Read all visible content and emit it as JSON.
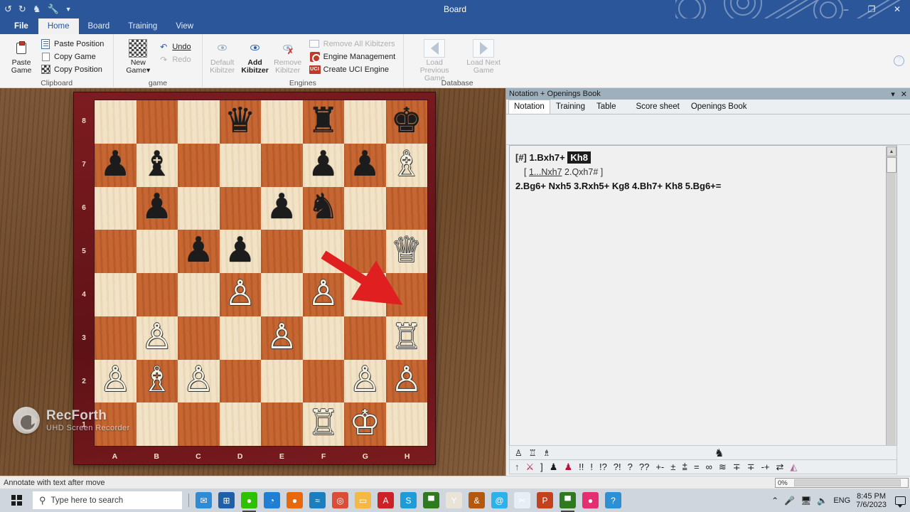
{
  "window": {
    "title": "Board",
    "quick_access": [
      "undo-icon",
      "redo-icon",
      "chess-knight-icon",
      "wrench-icon",
      "chevron-down-icon"
    ],
    "minimize": "–",
    "maximize": "❐",
    "close": "✕",
    "help": "?"
  },
  "ribbon": {
    "tabs": [
      {
        "label": "File",
        "active": false,
        "file": true
      },
      {
        "label": "Home",
        "active": true
      },
      {
        "label": "Board",
        "active": false
      },
      {
        "label": "Training",
        "active": false
      },
      {
        "label": "View",
        "active": false
      }
    ],
    "groups": [
      {
        "label": "Clipboard",
        "big": [
          {
            "label_line1": "Paste",
            "label_line2": "Game",
            "icon": "clipboard-icon",
            "disabled": false
          }
        ],
        "small": [
          {
            "label": "Paste Position",
            "icon": "paste-position-icon",
            "disabled": false
          },
          {
            "label": "Copy Game",
            "icon": "copy-game-icon",
            "disabled": false
          },
          {
            "label": "Copy Position",
            "icon": "copy-position-icon",
            "disabled": false
          }
        ]
      },
      {
        "label": "game",
        "big": [
          {
            "label_line1": "New",
            "label_line2": "Game▾",
            "icon": "new-game-board-icon",
            "disabled": false
          }
        ],
        "small": [
          {
            "label": "Undo",
            "icon": "undo-icon",
            "disabled": false
          },
          {
            "label": "Redo",
            "icon": "redo-icon",
            "disabled": true
          }
        ]
      },
      {
        "label": "Engines",
        "big": [
          {
            "label_line1": "Default",
            "label_line2": "Kibitzer",
            "icon": "default-kibitzer-icon",
            "disabled": true
          },
          {
            "label_line1": "Add",
            "label_line2": "Kibitzer",
            "icon": "add-kibitzer-icon",
            "disabled": false
          },
          {
            "label_line1": "Remove",
            "label_line2": "Kibitzer",
            "icon": "remove-kibitzer-icon",
            "disabled": true
          }
        ],
        "small": [
          {
            "label": "Remove All Kibitzers",
            "icon": "remove-all-kibitzers-icon",
            "disabled": true
          },
          {
            "label": "Engine Management",
            "icon": "engine-management-icon",
            "disabled": false
          },
          {
            "label": "Create UCI Engine",
            "icon": "uci-engine-icon",
            "disabled": false
          }
        ]
      },
      {
        "label": "Database",
        "big": [
          {
            "label_line1": "Load Previous",
            "label_line2": "Game",
            "icon": "arrow-left-icon",
            "disabled": true
          },
          {
            "label_line1": "Load Next",
            "label_line2": "Game",
            "icon": "arrow-right-icon",
            "disabled": true
          }
        ],
        "small": []
      }
    ]
  },
  "board": {
    "ranks": [
      "8",
      "7",
      "6",
      "5",
      "4",
      "3",
      "2",
      "1"
    ],
    "files": [
      "A",
      "B",
      "C",
      "D",
      "E",
      "F",
      "G",
      "H"
    ],
    "position": [
      [
        "",
        "",
        "",
        "q",
        "",
        "r",
        "",
        "k"
      ],
      [
        "p",
        "b",
        "",
        "",
        "",
        "p",
        "p",
        "B"
      ],
      [
        "",
        "p",
        "",
        "",
        "p",
        "n",
        "",
        ""
      ],
      [
        "",
        "",
        "p",
        "p",
        "",
        "",
        "",
        "Q"
      ],
      [
        "",
        "",
        "",
        "P",
        "",
        "P",
        "",
        ""
      ],
      [
        "",
        "P",
        "",
        "",
        "P",
        "",
        "",
        "R"
      ],
      [
        "P",
        "B",
        "P",
        "",
        "",
        "",
        "P",
        "P"
      ],
      [
        "",
        "",
        "",
        "",
        "",
        "R",
        "K",
        ""
      ]
    ],
    "arrow": {
      "from": "f6",
      "to": "h5",
      "color": "#e02020"
    }
  },
  "watermark": {
    "title": "RecForth",
    "subtitle": "UHD Screen Recorder",
    "icon": "video-camera-icon"
  },
  "notation_panel": {
    "title": "Notation + Openings Book",
    "collapse": "▾",
    "close": "✕",
    "tabs": [
      {
        "label": "Notation",
        "active": true
      },
      {
        "label": "Training",
        "active": false
      },
      {
        "label": "Table",
        "active": false
      },
      {
        "label": "Score sheet",
        "active": false,
        "spaced": true
      },
      {
        "label": "Openings Book",
        "active": false
      }
    ],
    "moves": {
      "tag": "[#]",
      "line1_main": "1.Bxh7+",
      "line1_highlight": "Kh8",
      "variation_open": "[",
      "variation_move1": "1...Nxh7",
      "variation_move2": "2.Qxh7#",
      "variation_close": "]",
      "line2": "2.Bg6+  Nxh5  3.Rxh5+  Kg8  4.Bh7+  Kh8  5.Bg6+="
    },
    "toolbar_pieces": [
      "white-pawn-icon",
      "white-rook-icon",
      "white-bishop-icon"
    ],
    "toolbar_knight": "black-knight-icon",
    "annotation_symbols": [
      "↑",
      "⚔",
      "]",
      "♟",
      "♟",
      "!!",
      "!",
      "!?",
      "?!",
      "?",
      "??",
      "+-",
      "±",
      "⩲",
      "=",
      "∞",
      "≋",
      "∓",
      "∓",
      "-+",
      "⇄",
      "⊘"
    ]
  },
  "statusbar": {
    "message": "Annotate with text after move",
    "progress_label": "0%",
    "progress_value": 0
  },
  "taskbar": {
    "start_icon": "windows-start-icon",
    "search_placeholder": "Type here to search",
    "search_icon": "search-icon",
    "apps": [
      {
        "name": "mail-icon",
        "glyph": "✉",
        "bg": "#2e8bd6",
        "active": false
      },
      {
        "name": "microsoft-store-icon",
        "glyph": "⊞",
        "bg": "#1f5fa8",
        "active": false
      },
      {
        "name": "wechat-icon",
        "glyph": "●",
        "bg": "#2dc100",
        "active": true
      },
      {
        "name": "microsoft-edge-icon",
        "glyph": "◔",
        "bg": "#1f7fd4",
        "active": false
      },
      {
        "name": "firefox-icon",
        "glyph": "●",
        "bg": "#e8690b",
        "active": false
      },
      {
        "name": "foxit-reader-icon",
        "glyph": "≈",
        "bg": "#1b7fbf",
        "active": false
      },
      {
        "name": "google-chrome-icon",
        "glyph": "◎",
        "bg": "#dd4b39",
        "active": false
      },
      {
        "name": "file-explorer-icon",
        "glyph": "▭",
        "bg": "#f4b942",
        "active": false
      },
      {
        "name": "adobe-acrobat-icon",
        "glyph": "A",
        "bg": "#cc2127",
        "active": false
      },
      {
        "name": "skype-icon",
        "glyph": "S",
        "bg": "#1e9cd7",
        "active": false
      },
      {
        "name": "green-app-icon",
        "glyph": "▀",
        "bg": "#2d7a1f",
        "active": false
      },
      {
        "name": "wine-glass-icon",
        "glyph": "Y",
        "bg": "#e9e3d8",
        "active": false
      },
      {
        "name": "amber-app-icon",
        "glyph": "&",
        "bg": "#b2590f",
        "active": false
      },
      {
        "name": "blue-swirl-icon",
        "glyph": "@",
        "bg": "#2cb2e8",
        "active": false
      },
      {
        "name": "snip-tool-icon",
        "glyph": "✂",
        "bg": "#e8eef5",
        "active": false
      },
      {
        "name": "powerpoint-icon",
        "glyph": "P",
        "bg": "#c4411e",
        "active": false
      },
      {
        "name": "green-app2-icon",
        "glyph": "▀",
        "bg": "#2d7a1f",
        "active": true
      },
      {
        "name": "recforth-recorder-icon",
        "glyph": "●",
        "bg": "#e52e71",
        "active": false
      },
      {
        "name": "help-app-icon",
        "glyph": "?",
        "bg": "#2d8fd4",
        "active": false
      }
    ],
    "tray": {
      "chevron": "⌃",
      "mic_icon": "microphone-icon",
      "display_icon": "display-icon",
      "volume_icon": "volume-icon",
      "language": "ENG",
      "time": "8:45 PM",
      "date": "7/6/2023",
      "action_center": "notification-icon"
    }
  },
  "colors": {
    "accent": "#2b579a",
    "board_light": "#f2e3c6",
    "board_dark": "#c4622c",
    "board_border": "#6e1519",
    "arrow": "#e02020"
  }
}
